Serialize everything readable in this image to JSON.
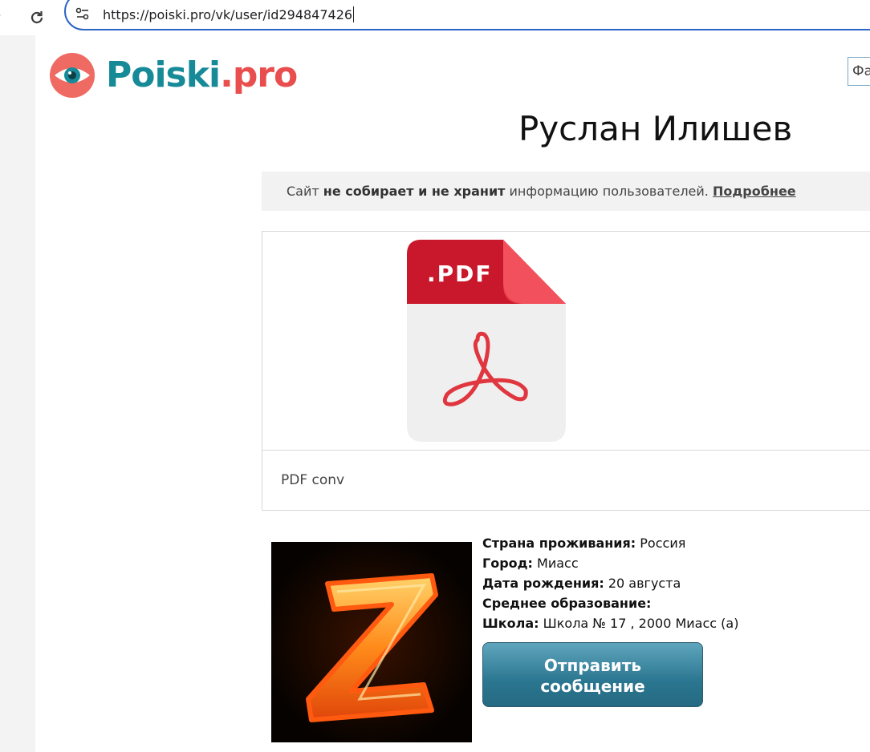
{
  "browser": {
    "url": "https://poiski.pro/vk/user/id294847426",
    "icons": {
      "forward": "arrow-right-icon",
      "reload": "reload-icon",
      "site_info": "tune-icon"
    }
  },
  "header": {
    "logo_main": "Poiski",
    "logo_tld": "pro",
    "search_input_value": "Фа"
  },
  "profile": {
    "name": "Руслан Илишев",
    "avatar_letter": "Z",
    "fields": [
      {
        "label": "Страна проживания:",
        "value": "Россия"
      },
      {
        "label": "Город:",
        "value": "Миасс"
      },
      {
        "label": "Дата рождения:",
        "value": "20 августа"
      },
      {
        "label": "Среднее образование:",
        "value": ""
      },
      {
        "label": "Школа:",
        "value": "Школа № 17 , 2000 Миасс (а)"
      }
    ],
    "send_button_line1": "Отправить",
    "send_button_line2": "сообщение"
  },
  "notice": {
    "prefix": "Сайт ",
    "bold": "не собирает и не хранит",
    "suffix": " информацию пользователей. ",
    "link": "Подробнее"
  },
  "ad": {
    "icon_label": ".PDF",
    "caption": "PDF conv"
  },
  "colors": {
    "brand_teal": "#178a98",
    "brand_red": "#e94e4e",
    "button_blue": "#2b7690",
    "pdf_red": "#c9182b"
  }
}
